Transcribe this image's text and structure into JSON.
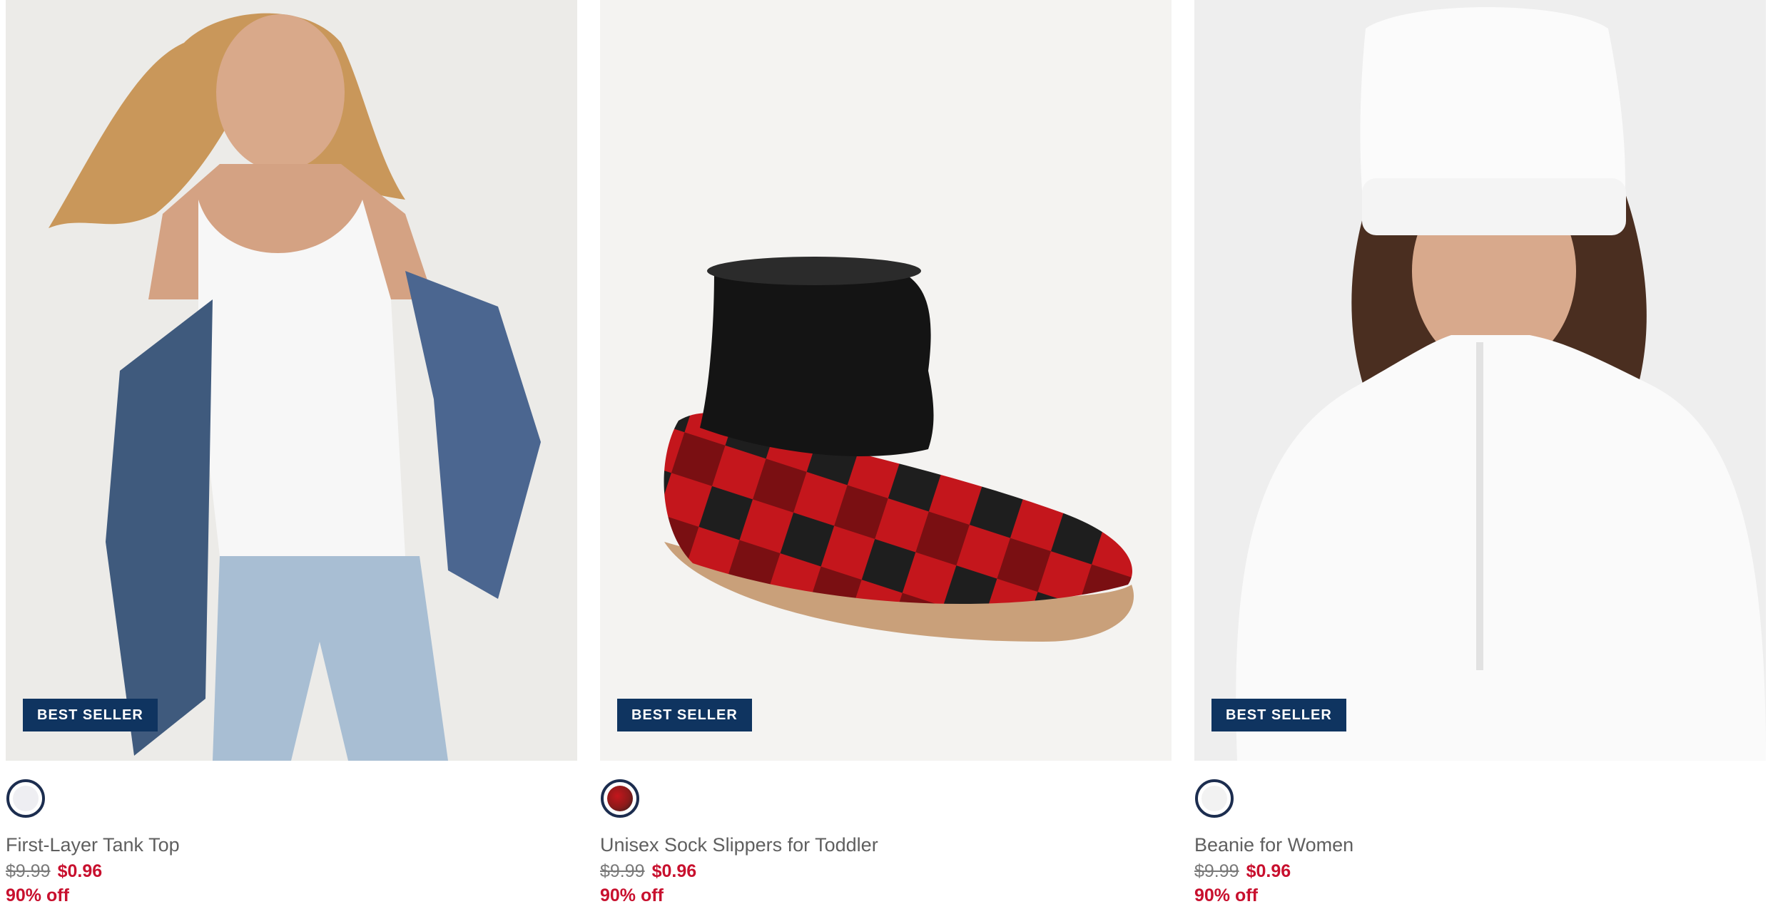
{
  "products": [
    {
      "badge": "BEST SELLER",
      "name": "First-Layer Tank Top",
      "was_price": "$9.99",
      "sale_price": "$0.96",
      "discount": "90% off",
      "swatch_color": "#eeeef2",
      "image": "model wearing white tank top, denim jacket and light jeans"
    },
    {
      "badge": "BEST SELLER",
      "name": "Unisex Sock Slippers for Toddler",
      "was_price": "$9.99",
      "sale_price": "$0.96",
      "discount": "90% off",
      "swatch_color": "#8b1a1a",
      "image": "red and black buffalo plaid sock slipper with black knit cuff"
    },
    {
      "badge": "BEST SELLER",
      "name": "Beanie for Women",
      "was_price": "$9.99",
      "sale_price": "$0.96",
      "discount": "90% off",
      "swatch_color": "#f2f2f2",
      "image": "model wearing white beanie and white sherpa half-zip"
    }
  ],
  "colors": {
    "badge_bg": "#0f3460",
    "sale_red": "#c8102e",
    "text_gray": "#5f5f5f",
    "swatch_ring": "#1c2d4f"
  }
}
